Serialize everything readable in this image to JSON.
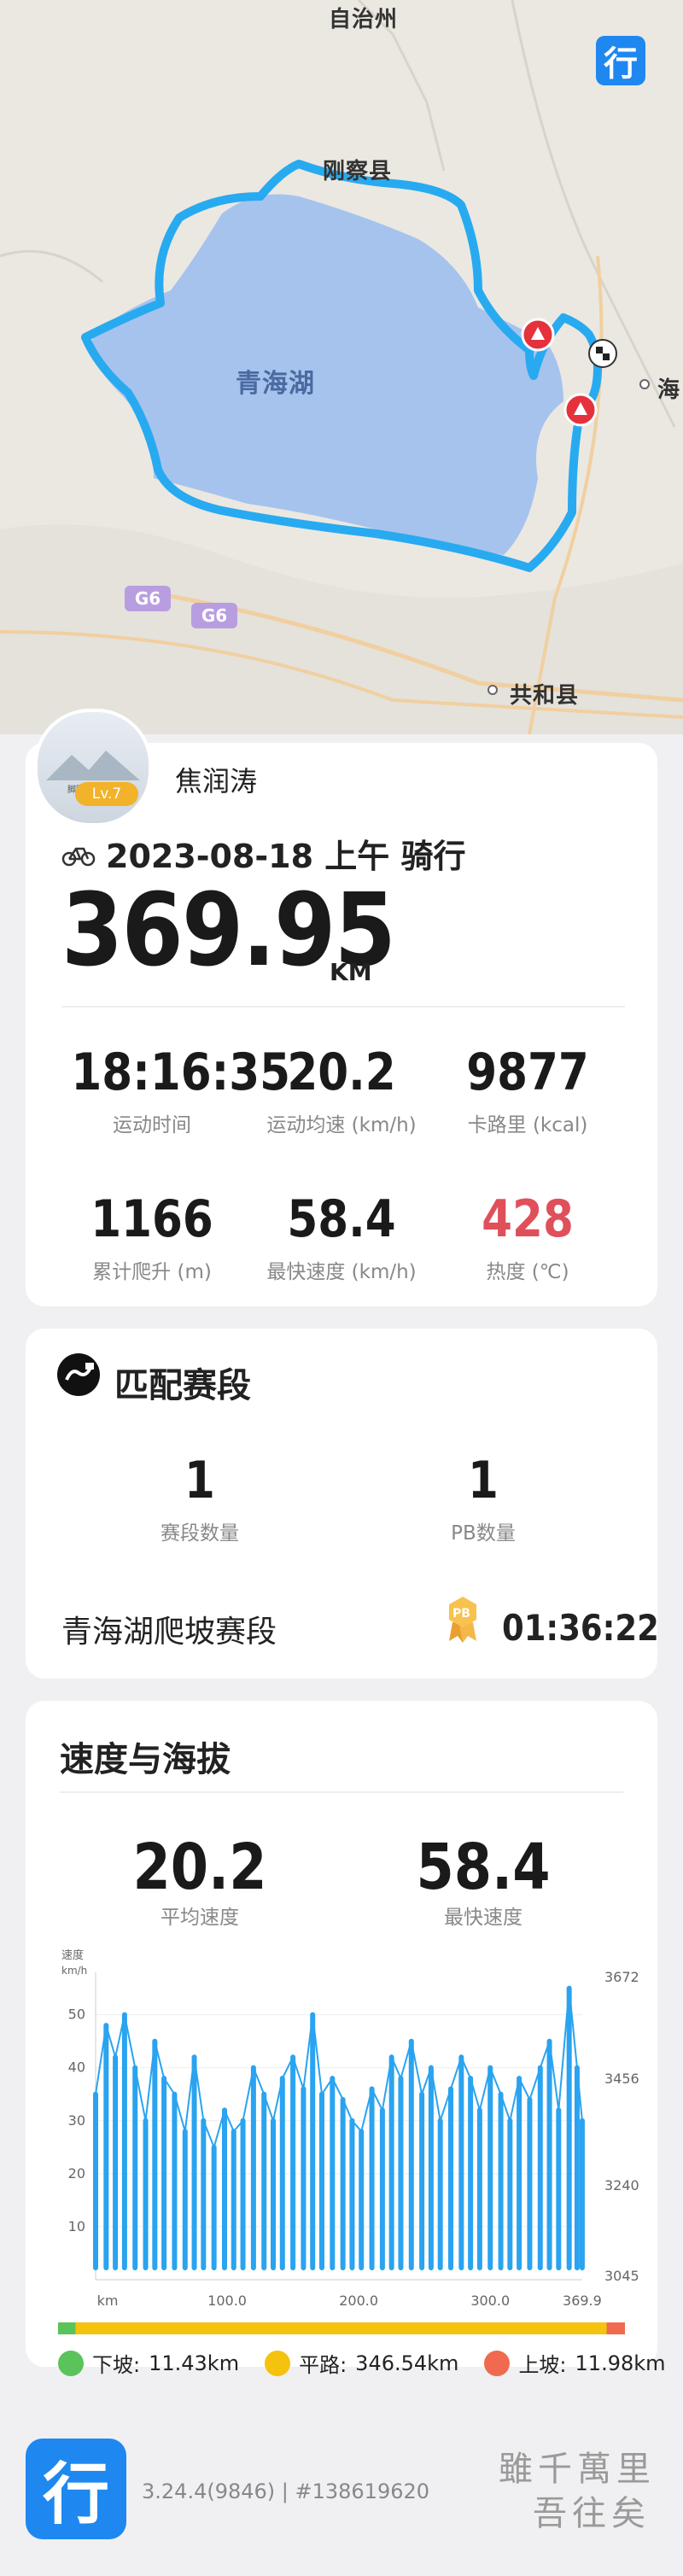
{
  "map": {
    "labels": {
      "top_town": "自治州",
      "gangcha": "刚察县",
      "lake": "青海湖",
      "hai": "海",
      "gonghe": "共和县"
    },
    "roads": [
      "G6",
      "G6"
    ],
    "app_icon_glyph": "行"
  },
  "profile": {
    "username": "焦润涛",
    "level": "Lv.7",
    "avatar_caption": "脚踏天涯攀峰"
  },
  "activity": {
    "date_line": "2023-08-18 上午 骑行",
    "distance": "369.95",
    "distance_unit": "KM"
  },
  "stats": [
    {
      "value": "18:16:35",
      "label": "运动时间"
    },
    {
      "value": "20.2",
      "label": "运动均速 (km/h)"
    },
    {
      "value": "9877",
      "label": "卡路里 (kcal)"
    },
    {
      "value": "1166",
      "label": "累计爬升 (m)"
    },
    {
      "value": "58.4",
      "label": "最快速度 (km/h)"
    },
    {
      "value": "428",
      "label": "热度 (℃)"
    }
  ],
  "segments": {
    "title": "匹配赛段",
    "count_value": "1",
    "count_label": "赛段数量",
    "pb_value": "1",
    "pb_label": "PB数量",
    "segment_name": "青海湖爬坡赛段",
    "pb_badge": "PB",
    "segment_time": "01:36:22"
  },
  "speed_elev": {
    "title": "速度与海拔",
    "avg_value": "20.2",
    "avg_label": "平均速度",
    "max_value": "58.4",
    "max_label": "最快速度"
  },
  "legend": [
    {
      "label": "下坡:",
      "value": "11.43km",
      "color": "#5ac35a"
    },
    {
      "label": "平路:",
      "value": "346.54km",
      "color": "#f5c20e"
    },
    {
      "label": "上坡:",
      "value": "11.98km",
      "color": "#ef6a4e"
    }
  ],
  "footer": {
    "logo_glyph": "行",
    "version": "3.24.4(9846) | #138619620",
    "calligraphy_line1": "雖千萬里",
    "calligraphy_line2": "吾往矣"
  },
  "chart_data": {
    "type": "line",
    "ylabel_left": "速度",
    "ylabel_left_unit": "km/h",
    "x_ticks": [
      "km",
      "100.0",
      "200.0",
      "300.0",
      "369.9"
    ],
    "y_left_ticks": [
      "50",
      "40",
      "30",
      "20",
      "10"
    ],
    "y_right_ticks": [
      "3672",
      "3456",
      "3240",
      "3045"
    ],
    "ylim_left": [
      0,
      58
    ],
    "ylim_right": [
      3045,
      3672
    ],
    "xlim": [
      0,
      369.95
    ],
    "series": [
      {
        "name": "",
        "color": "#2aa3f0",
        "x": [
          0,
          8,
          15,
          22,
          30,
          38,
          45,
          52,
          60,
          68,
          75,
          82,
          90,
          98,
          105,
          112,
          120,
          128,
          135,
          142,
          150,
          158,
          165,
          172,
          180,
          188,
          195,
          202,
          210,
          218,
          225,
          232,
          240,
          248,
          255,
          262,
          270,
          278,
          285,
          292,
          300,
          308,
          315,
          322,
          330,
          338,
          345,
          352,
          360,
          366,
          369.9
        ],
        "y": [
          35,
          48,
          42,
          50,
          40,
          30,
          45,
          38,
          35,
          28,
          42,
          30,
          25,
          32,
          28,
          30,
          40,
          35,
          30,
          38,
          42,
          36,
          50,
          35,
          38,
          34,
          30,
          28,
          36,
          32,
          42,
          38,
          45,
          35,
          40,
          30,
          36,
          42,
          38,
          32,
          40,
          35,
          30,
          38,
          34,
          40,
          45,
          32,
          55,
          40,
          30
        ]
      }
    ],
    "progress_bar": {
      "segments": [
        {
          "name": "下坡",
          "km": 11.43,
          "color": "#5ac35a"
        },
        {
          "name": "平路",
          "km": 346.54,
          "color": "#f5c20e"
        },
        {
          "name": "上坡",
          "km": 11.98,
          "color": "#ef6a4e"
        }
      ]
    }
  }
}
